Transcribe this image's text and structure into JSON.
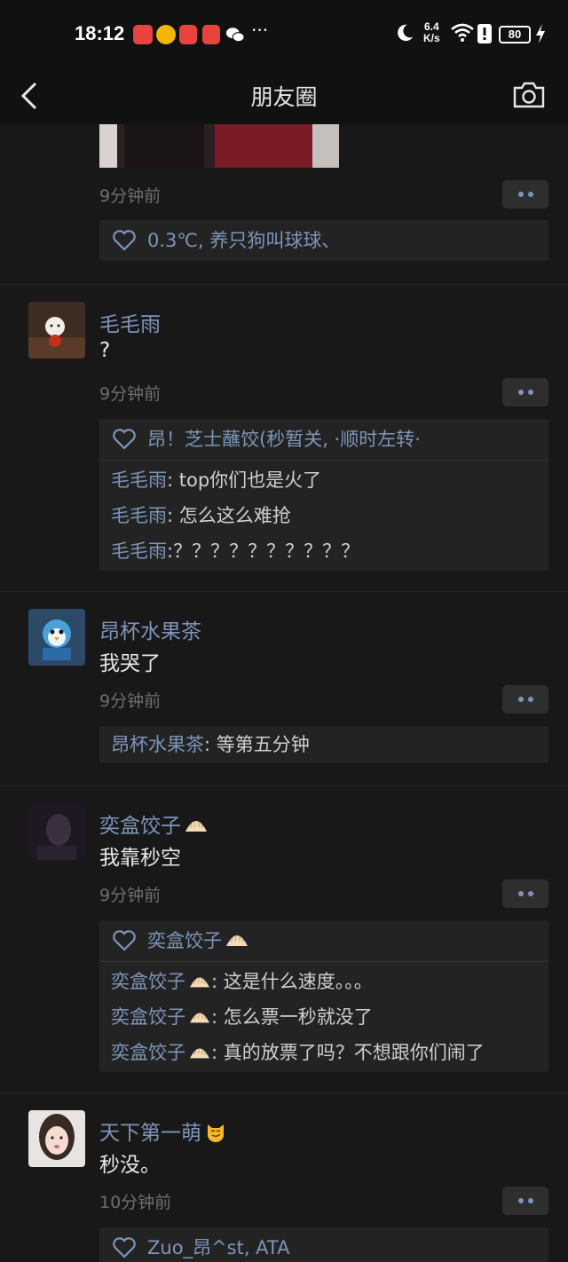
{
  "status": {
    "time": "18:12",
    "speed_value": "6.4",
    "speed_unit": "K/s",
    "battery": "80",
    "more": "···",
    "icons": [
      "app-icon-red",
      "weibo-icon",
      "huawei-icon",
      "app-icon-red-2",
      "wechat-icon",
      "moon-icon",
      "wifi-icon",
      "alert-icon",
      "battery-icon",
      "charging-icon"
    ]
  },
  "nav": {
    "title": "朋友圈"
  },
  "colors": {
    "accent_name": "#7e95b9",
    "background": "#181818",
    "bar": "#111111",
    "panel": "#232323"
  },
  "posts": [
    {
      "time": "9分钟前",
      "likes": "0.3℃, 养只狗叫球球、"
    },
    {
      "name": "毛毛雨",
      "content": "?",
      "time": "9分钟前",
      "likes": "昂！芝士蘸饺(秒暂关, ·顺时左转·",
      "comments": [
        {
          "name": "毛毛雨",
          "text": ": top你们也是火了"
        },
        {
          "name": "毛毛雨",
          "text": ": 怎么这么难抢"
        },
        {
          "name": "毛毛雨",
          "text": ":？？？？？？？？？？"
        }
      ]
    },
    {
      "name": "昂杯水果茶",
      "content": "我哭了",
      "time": "9分钟前",
      "comments": [
        {
          "name": "昂杯水果茶",
          "text": ": 等第五分钟"
        }
      ]
    },
    {
      "name": "奕盒饺子",
      "content": "我靠秒空",
      "time": "9分钟前",
      "likes": "奕盒饺子",
      "comments": [
        {
          "name": "奕盒饺子",
          "text": ": 这是什么速度。。。"
        },
        {
          "name": "奕盒饺子",
          "text": ": 怎么票一秒就没了"
        },
        {
          "name": "奕盒饺子",
          "text": ":  真的放票了吗？不想跟你们闹了"
        }
      ]
    },
    {
      "name": "天下第一萌",
      "content": "秒没。",
      "time": "10分钟前",
      "likes": "Zuo_昂^st, ATA"
    }
  ]
}
